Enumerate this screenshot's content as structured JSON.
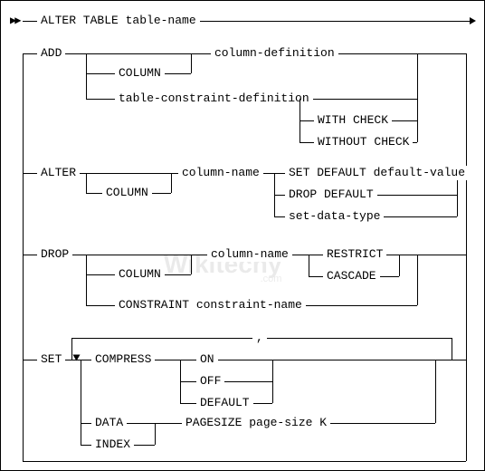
{
  "title": "ALTER TABLE table-name",
  "watermark": "Wikitechy",
  "watermark_sub": ".com",
  "add": {
    "keyword": "ADD",
    "column_kw": "COLUMN",
    "col_def": "column-definition",
    "tbl_constraint": "table-constraint-definition",
    "with_check": "WITH CHECK",
    "without_check": "WITHOUT CHECK"
  },
  "alter": {
    "keyword": "ALTER",
    "column_kw": "COLUMN",
    "col_name": "column-name",
    "set_default": "SET DEFAULT default-value",
    "drop_default": "DROP DEFAULT",
    "set_dtype": "set-data-type"
  },
  "drop": {
    "keyword": "DROP",
    "column_kw": "COLUMN",
    "col_name": "column-name",
    "restrict": "RESTRICT",
    "cascade": "CASCADE",
    "constraint": "CONSTRAINT constraint-name"
  },
  "set": {
    "keyword": "SET",
    "compress": "COMPRESS",
    "on": "ON",
    "off": "OFF",
    "default": "DEFAULT",
    "data": "DATA",
    "index": "INDEX",
    "pagesize": "PAGESIZE page-size K",
    "loop_sep": ","
  }
}
